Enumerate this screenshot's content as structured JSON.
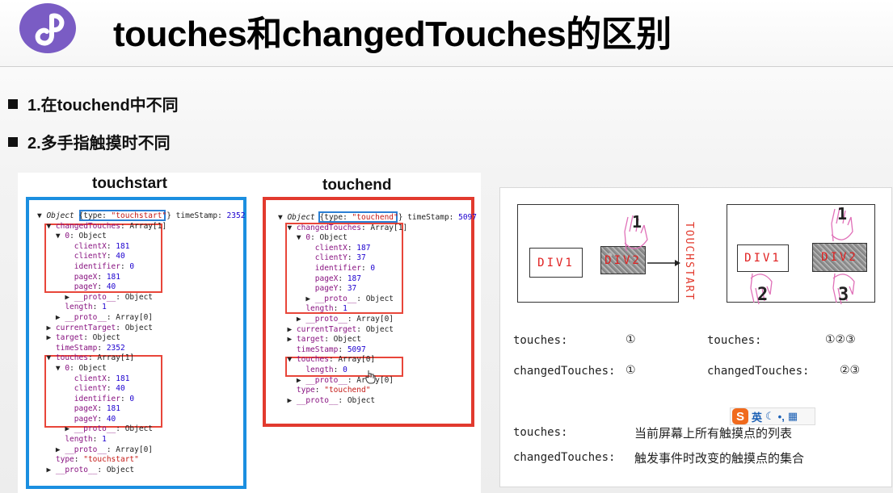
{
  "slide": {
    "title": "touches和changedTouches的区别",
    "bullets": [
      "1.在touchend中不同",
      "2.多手指触摸时不同"
    ]
  },
  "left_panel": {
    "touchstart_title": "touchstart",
    "touchend_title": "touchend",
    "touchstart_code": [
      "▼ Object {type: \"touchstart\"} timeStamp: 2352",
      "  ▼ changedTouches: Array[1]",
      "    ▼ 0: Object",
      "        clientX: 181",
      "        clientY: 40",
      "        identifier: 0",
      "        pageX: 181",
      "        pageY: 40",
      "      ▶ __proto__: Object",
      "      length: 1",
      "    ▶ __proto__: Array[0]",
      "  ▶ currentTarget: Object",
      "  ▶ target: Object",
      "    timeStamp: 2352",
      "  ▼ touches: Array[1]",
      "    ▼ 0: Object",
      "        clientX: 181",
      "        clientY: 40",
      "        identifier: 0",
      "        pageX: 181",
      "        pageY: 40",
      "      ▶ __proto__: Object",
      "      length: 1",
      "    ▶ __proto__: Array[0]",
      "    type: \"touchstart\"",
      "  ▶ __proto__: Object"
    ],
    "touchend_code": [
      "▼ Object {type: \"touchend\"} timeStamp: 5097",
      "  ▼ changedTouches: Array[1]",
      "    ▼ 0: Object",
      "        clientX: 187",
      "        clientY: 37",
      "        identifier: 0",
      "        pageX: 187",
      "        pageY: 37",
      "      ▶ __proto__: Object",
      "      length: 1",
      "    ▶ __proto__: Array[0]",
      "  ▶ currentTarget: Object",
      "  ▶ target: Object",
      "    timeStamp: 5097",
      "  ▼ touches: Array[0]",
      "      length: 0",
      "    ▶ __proto__: Array[0]",
      "    type: \"touchend\"",
      "  ▶ __proto__: Object"
    ]
  },
  "right_panel": {
    "div1_label": "DIV1",
    "div2_label": "DIV2",
    "vertical_label": "TOUCHSTART",
    "finger_1": "1",
    "finger_2": "2",
    "finger_3": "3",
    "touches_label": "touches:",
    "changed_label": "changedTouches:",
    "left_touches_value": "①",
    "left_changed_value": "①",
    "right_touches_value": "①②③",
    "right_changed_value": "②③",
    "ime_lang": "英",
    "def_touches_label": "touches:",
    "def_touches_text": "当前屏幕上所有触摸点的列表",
    "def_changed_label": "changedTouches:",
    "def_changed_text": "触发事件时改变的触摸点的集合"
  },
  "colors": {
    "accent_blue": "#1b8fe0",
    "accent_red": "#e23a2e",
    "logo_purple": "#7a5cc4"
  },
  "icons": [
    "mini-program-logo-icon",
    "arrow-right-icon",
    "hand-icon",
    "sogou-ime-icon"
  ]
}
